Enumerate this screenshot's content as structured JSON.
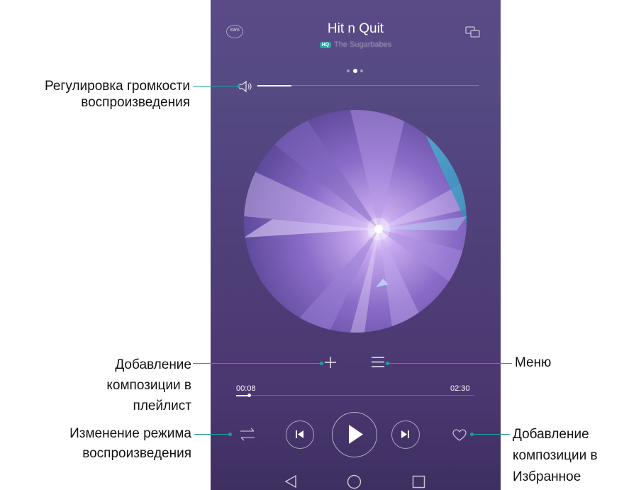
{
  "player": {
    "title": "Hit n Quit",
    "hq_badge": "HQ",
    "artist": "The Sugarbabes",
    "sws_label": "SWS",
    "time_elapsed": "00:08",
    "time_total": "02:30",
    "progress_fraction": 0.053,
    "volume_fraction": 0.14,
    "page_indicator": {
      "count": 3,
      "active": 2
    }
  },
  "callouts": {
    "volume": "Регулировка громкости воспроизведения",
    "add_playlist": "Добавление композиции в плейлист",
    "menu": "Меню",
    "play_mode": "Изменение режима воспроизведения",
    "favorite": "Добавление композиции в Избранное"
  },
  "icons": {
    "sws": "sws-icon",
    "cast": "cast-icon",
    "volume": "speaker-icon",
    "add": "plus-icon",
    "menu": "list-menu-icon",
    "mode": "repeat-arrows-icon",
    "prev": "skip-previous-icon",
    "play": "play-icon",
    "next": "skip-next-icon",
    "favorite": "heart-icon",
    "nav_back": "back-triangle-icon",
    "nav_home": "home-circle-icon",
    "nav_recent": "recent-square-icon"
  },
  "colors": {
    "accent_teal": "#1f9f9a",
    "background": "#514280"
  }
}
